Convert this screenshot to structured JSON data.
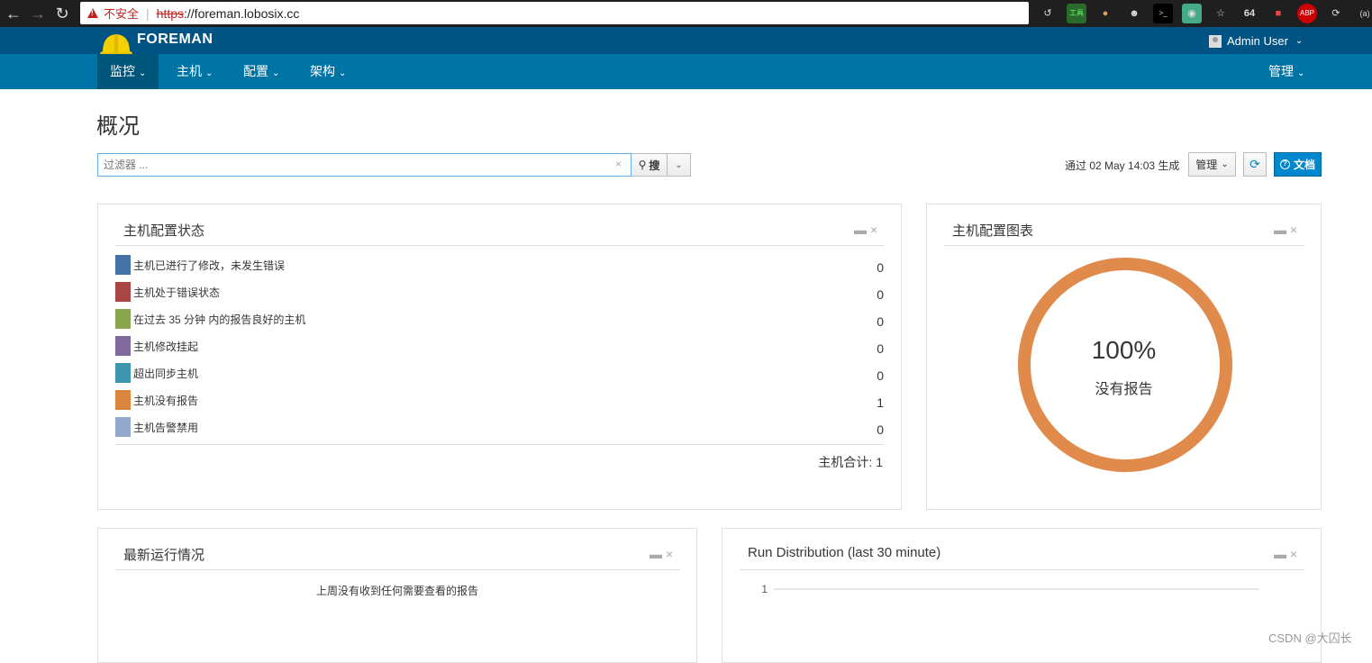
{
  "browser": {
    "insecure_label": "不安全",
    "url_scheme": "https",
    "url_host": "://foreman.lobosix.cc",
    "extensions": [
      "history-icon",
      "tools-icon",
      "cookie-icon",
      "mask-icon",
      "terminal-icon",
      "chrome-icon",
      "star-icon",
      "64-icon",
      "flag-icon",
      "abp-icon",
      "refresh-ext-icon",
      "settings-icon"
    ]
  },
  "header": {
    "brand": "FOREMAN",
    "user": "Admin User"
  },
  "nav": {
    "items": [
      {
        "label": "监控"
      },
      {
        "label": "主机"
      },
      {
        "label": "配置"
      },
      {
        "label": "架构"
      }
    ],
    "admin": "管理"
  },
  "page": {
    "title": "概况",
    "search_placeholder": "过滤器 ...",
    "search_button": "搜",
    "generated": "通过 02 May 14:03 生成",
    "manage_button": "管理",
    "docs_button": "文档"
  },
  "status_widget": {
    "title": "主机配置状态",
    "rows": [
      {
        "label": "主机已进行了修改，未发生错误",
        "count": "0",
        "color": "#4572a7"
      },
      {
        "label": "主机处于错误状态",
        "count": "0",
        "color": "#aa4643"
      },
      {
        "label": "在过去 35 分钟 内的报告良好的主机",
        "count": "0",
        "color": "#89a54e"
      },
      {
        "label": "主机修改挂起",
        "count": "0",
        "color": "#80699b"
      },
      {
        "label": "超出同步主机",
        "count": "0",
        "color": "#3d96ae"
      },
      {
        "label": "主机没有报告",
        "count": "1",
        "color": "#db843d"
      },
      {
        "label": "主机告警禁用",
        "count": "0",
        "color": "#92a8cd"
      }
    ],
    "total": "主机合计: 1"
  },
  "chart_widget": {
    "title": "主机配置图表",
    "percent": "100%",
    "subtitle": "没有报告",
    "ring_color": "#e08a4b"
  },
  "latest_widget": {
    "title": "最新运行情况",
    "message": "上周没有收到任何需要查看的报告"
  },
  "distribution_widget": {
    "title": "Run Distribution (last 30 minute)"
  },
  "chart_data": {
    "type": "line",
    "title": "Run Distribution (last 30 minute)",
    "y_ticks": [
      1
    ],
    "series": []
  },
  "watermark": "CSDN @大囚长"
}
